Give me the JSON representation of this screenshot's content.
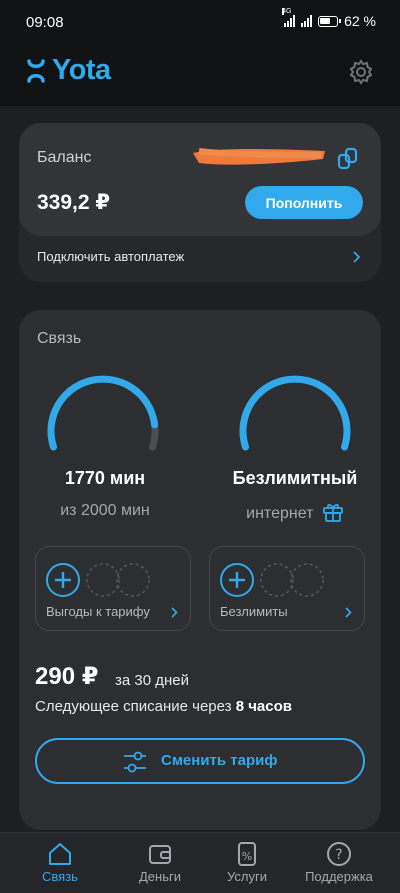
{
  "status_bar": {
    "time": "09:08",
    "battery": "62 %",
    "network": "4G"
  },
  "header": {
    "brand": "Yota"
  },
  "balance": {
    "label": "Баланс",
    "value": "339,2 ₽",
    "topup_label": "Пополнить",
    "autopay_label": "Подключить автоплатеж"
  },
  "connection": {
    "title": "Связь",
    "minutes": {
      "main": "1770 мин",
      "sub": "из 2000 мин",
      "fraction_remaining": 0.885
    },
    "internet": {
      "main": "Безлимитный",
      "sub": "интернет",
      "fraction_remaining": 1.0
    },
    "addons": [
      {
        "label": "Выгоды к тарифу"
      },
      {
        "label": "Безлимиты"
      }
    ],
    "price": "290 ₽",
    "period": "за 30 дней",
    "next_charge_text": "Следующее списание через",
    "next_charge_time": "8 часов",
    "change_tariff_label": "Сменить тариф"
  },
  "nav": [
    {
      "label": "Связь",
      "icon": "home-icon",
      "active": true
    },
    {
      "label": "Деньги",
      "icon": "wallet-icon",
      "active": false
    },
    {
      "label": "Услуги",
      "icon": "services-icon",
      "active": false
    },
    {
      "label": "Поддержка",
      "icon": "help-icon",
      "active": false
    }
  ],
  "colors": {
    "accent": "#32a9ea",
    "background": "#1e1f21",
    "card": "#2c2e31",
    "redaction": "#f07a3c"
  }
}
